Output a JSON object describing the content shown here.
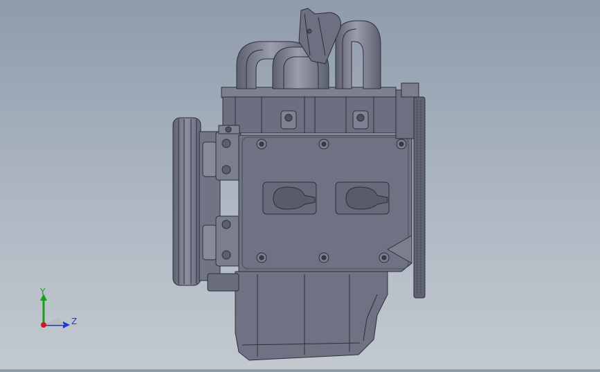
{
  "viewport": {
    "model": "engine-assembly",
    "colors": {
      "background_top": "#8e9bab",
      "background_bottom": "#c3c9d0",
      "body": "#6f7282",
      "body_light": "#8a8d9c",
      "edge": "#2c2e38",
      "highlight": "#a6a9b6"
    }
  },
  "triad": {
    "y_label": "Y",
    "z_label": "Z",
    "colors": {
      "y": "#18a018",
      "z": "#1e3ad8",
      "x": "#d01818"
    }
  }
}
